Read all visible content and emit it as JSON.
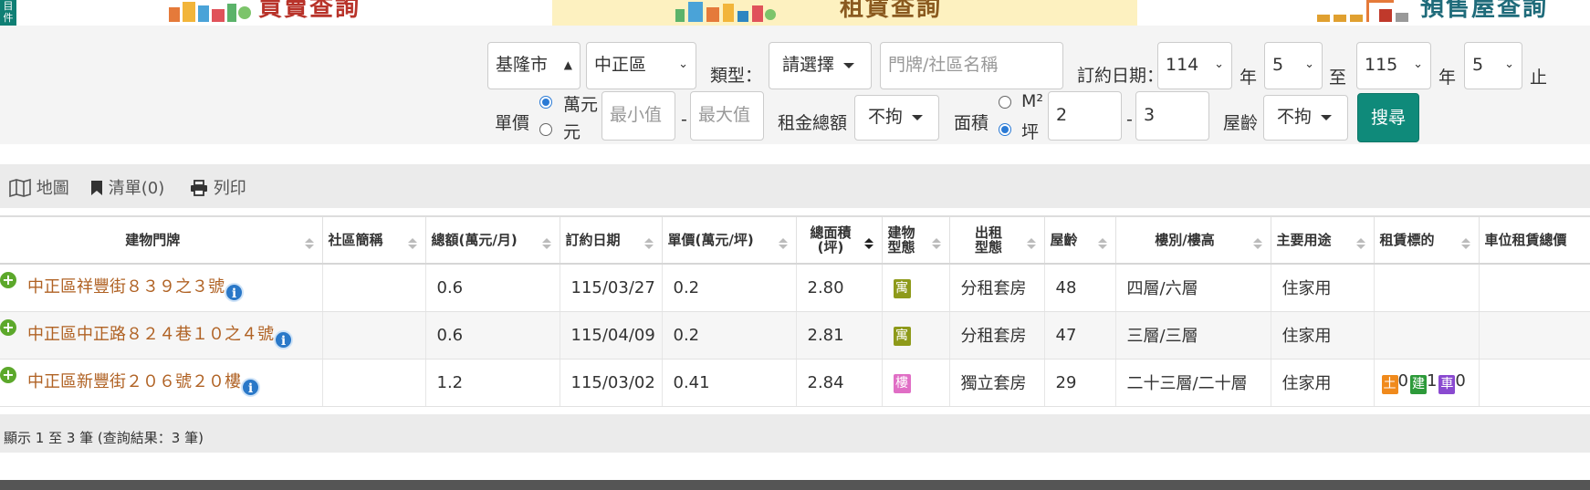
{
  "banner": {
    "side_tab": "目\n件",
    "tab1_title": "買賣查詢",
    "tab2_title": "租賃查詢",
    "tab3_title": "預售屋查詢"
  },
  "search": {
    "city": "基隆市",
    "district": "中正區",
    "type_label": "類型：",
    "type_value": "請選擇",
    "address_placeholder": "門牌/社區名稱",
    "date_label": "訂約日期：",
    "year_from": "114",
    "year_unit": "年",
    "month_from": "5",
    "to_label": "至",
    "year_to": "115",
    "year_unit2": "年",
    "month_to": "5",
    "end_label": "止",
    "unit_price_label": "單價",
    "unit_wan": "萬元",
    "unit_yuan": "元",
    "min_placeholder": "最小值",
    "dash1": "-",
    "max_placeholder": "最大值",
    "total_rent_label": "租金總額",
    "total_rent_value": "不拘",
    "area_label": "面積",
    "area_m2": "M²",
    "area_ping": "坪",
    "area_min": "2",
    "dash2": "-",
    "area_max": "3",
    "age_label": "屋齡",
    "age_value": "不拘",
    "search_button": "搜尋"
  },
  "toolbar": {
    "map": "地圖",
    "list": "清單(0)",
    "print": "列印"
  },
  "table": {
    "headers": [
      "建物門牌",
      "社區簡稱",
      "總額(萬元/月)",
      "訂約日期",
      "單價(萬元/坪)",
      "總面積(坪)",
      "建物型態",
      "出租型態",
      "屋齡",
      "樓別/樓高",
      "主要用途",
      "租賃標的",
      "車位租賃總價"
    ],
    "rows": [
      {
        "address": "中正區祥豐街８３９之３號",
        "community": "",
        "total": "0.6",
        "date": "115/03/27",
        "unit_price": "0.2",
        "area": "2.80",
        "btype": "寓",
        "rent_type": "分租套房",
        "age": "48",
        "floor": "四層/六層",
        "use": "住家用",
        "tag": "",
        "parking": ""
      },
      {
        "address": "中正區中正路８２４巷１０之４號",
        "community": "",
        "total": "0.6",
        "date": "115/04/09",
        "unit_price": "0.2",
        "area": "2.81",
        "btype": "寓",
        "rent_type": "分租套房",
        "age": "47",
        "floor": "三層/三層",
        "use": "住家用",
        "tag": "",
        "parking": ""
      },
      {
        "address": "中正區新豐街２０６號２０樓",
        "community": "",
        "total": "1.2",
        "date": "115/03/02",
        "unit_price": "0.41",
        "area": "2.84",
        "btype": "樓",
        "rent_type": "獨立套房",
        "age": "29",
        "floor": "二十三層/二十層",
        "use": "住家用",
        "tag_land": "土",
        "tag_land_n": "0",
        "tag_bldg": "建",
        "tag_bldg_n": "1",
        "tag_car": "車",
        "tag_car_n": "0",
        "parking": ""
      }
    ]
  },
  "footer": {
    "summary": "顯示 1 至 3 筆 (查詢結果：3 筆)"
  },
  "colors": {
    "accent": "#0f8a7a",
    "link": "#b06224"
  }
}
